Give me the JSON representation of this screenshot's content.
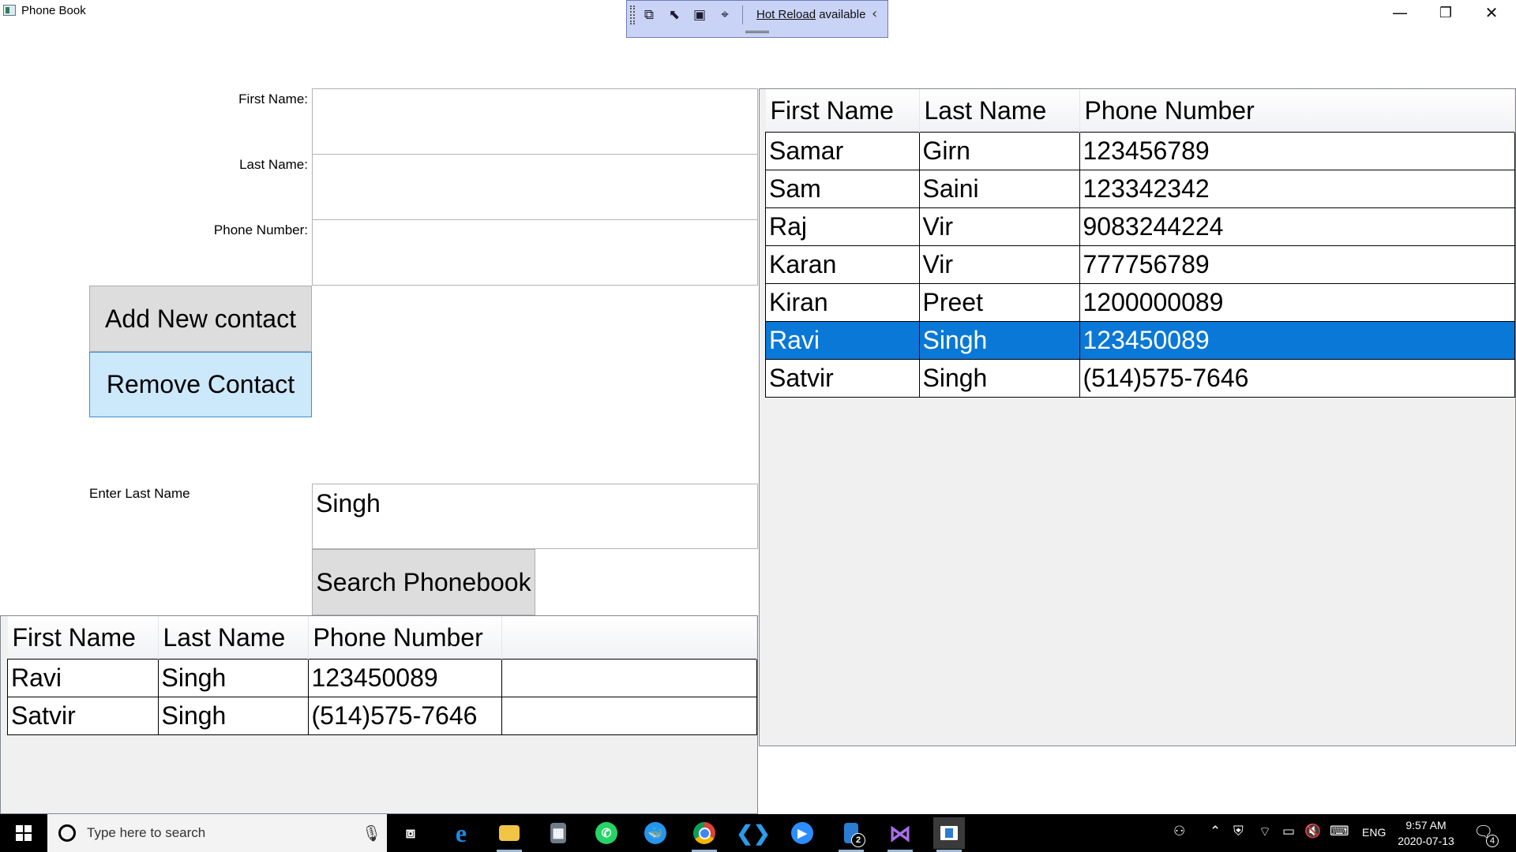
{
  "window": {
    "title": "Phone Book",
    "controls": {
      "minimize": "—",
      "maximize": "❐",
      "close": "✕"
    }
  },
  "hot_reload": {
    "link": "Hot Reload",
    "suffix": " available",
    "collapse": "‹"
  },
  "form": {
    "first_name_label": "First Name:",
    "last_name_label": "Last Name:",
    "phone_label": "Phone Number:",
    "first_name_value": "",
    "last_name_value": "",
    "phone_value": "",
    "add_button": "Add New contact",
    "remove_button": "Remove Contact",
    "search_label": "Enter Last Name",
    "search_value": "Singh",
    "search_button": "Search Phonebook"
  },
  "contacts_grid": {
    "columns": [
      "First Name",
      "Last Name",
      "Phone Number"
    ],
    "rows": [
      [
        "Samar",
        "Girn",
        "123456789"
      ],
      [
        "Sam",
        "Saini",
        "123342342"
      ],
      [
        "Raj",
        "Vir",
        "9083244224"
      ],
      [
        "Karan",
        "Vir",
        "777756789"
      ],
      [
        "Kiran",
        "Preet",
        "1200000089"
      ],
      [
        "Ravi",
        "Singh",
        "123450089"
      ],
      [
        "Satvir",
        "Singh",
        "(514)575-7646"
      ]
    ],
    "selected_row": 5
  },
  "results_grid": {
    "columns": [
      "First Name",
      "Last Name",
      "Phone Number"
    ],
    "rows": [
      [
        "Ravi",
        "Singh",
        "123450089"
      ],
      [
        "Satvir",
        "Singh",
        "(514)575-7646"
      ]
    ]
  },
  "taskbar": {
    "search_placeholder": "Type here to search",
    "apps": [
      "task-view",
      "edge",
      "file-explorer",
      "calculator",
      "whatsapp",
      "docker",
      "chrome",
      "vscode",
      "zoom",
      "word-pad",
      "visual-studio",
      "phone-book"
    ],
    "badge_count": "2",
    "language": "ENG",
    "time": "9:57 AM",
    "date": "2020-07-13",
    "notifications": "4"
  }
}
